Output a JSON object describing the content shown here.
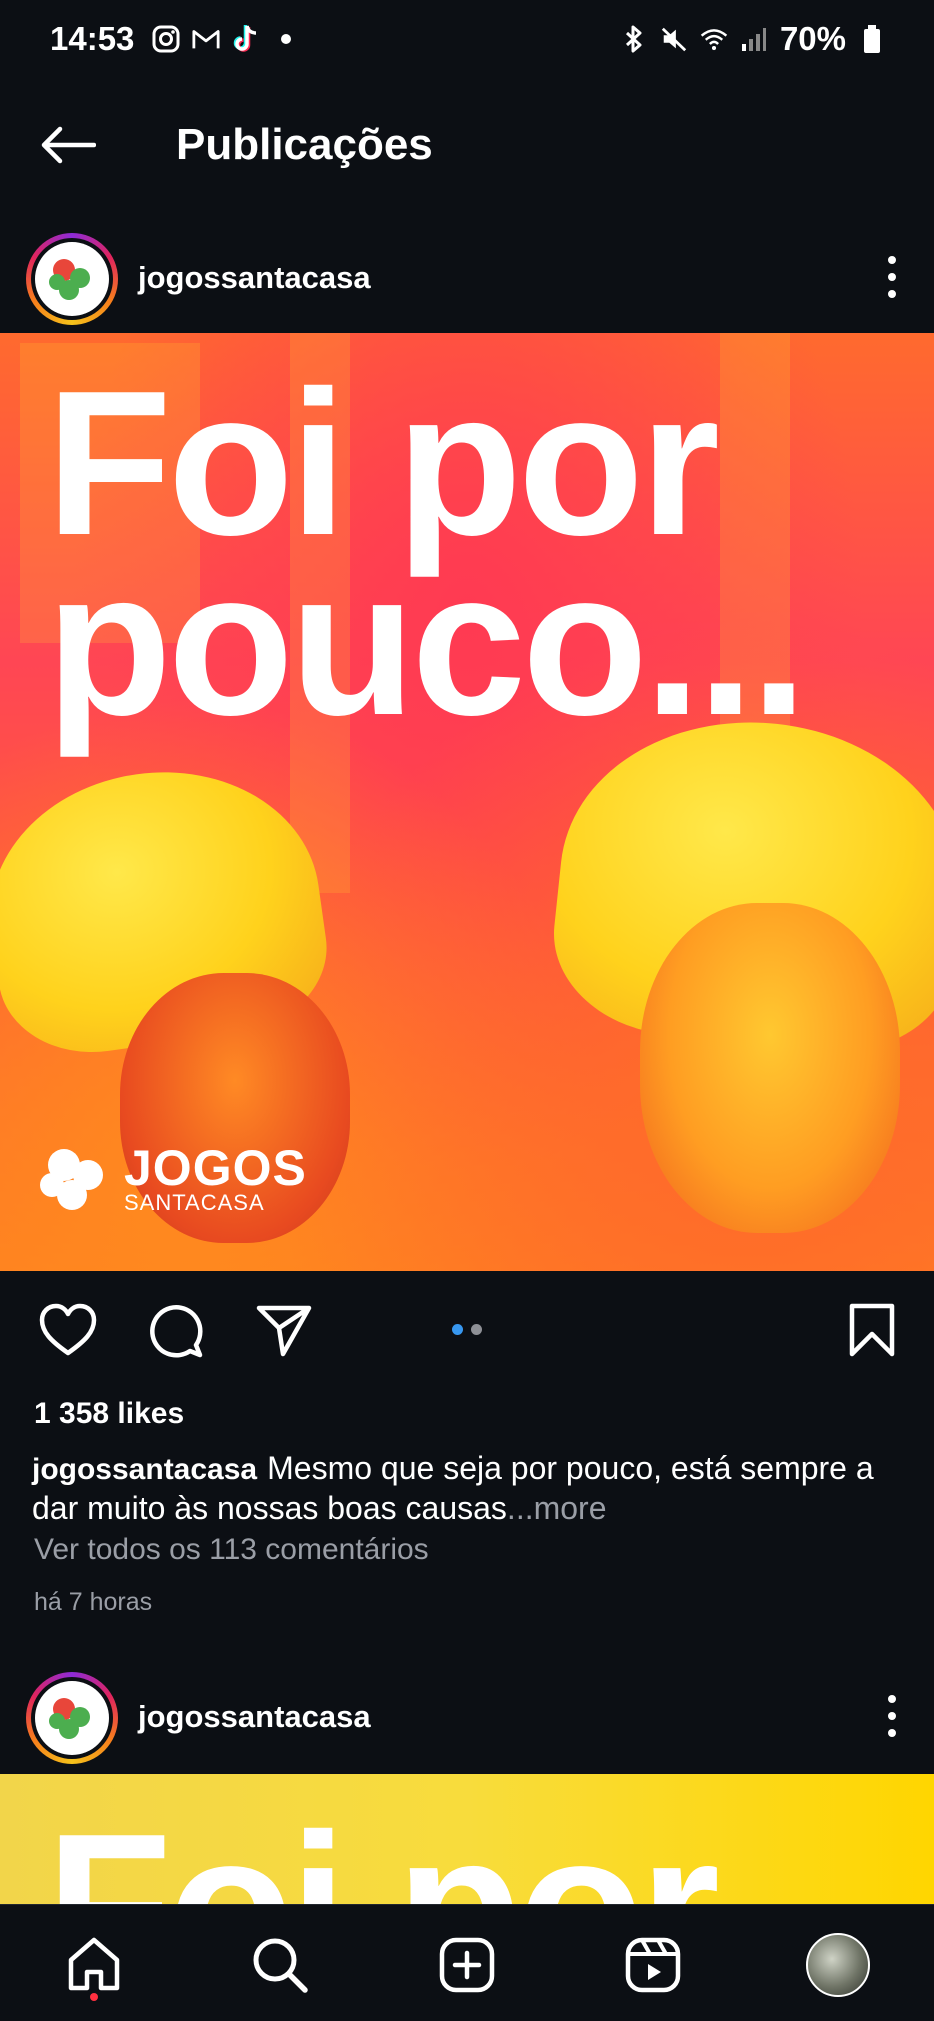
{
  "status_bar": {
    "time": "14:53",
    "left_icons": [
      "instagram-icon",
      "gmail-icon",
      "tiktok-icon",
      "dot-icon"
    ],
    "right_icons": [
      "bluetooth-icon",
      "mute-icon",
      "wifi-icon",
      "signal-icon",
      "battery-icon"
    ],
    "battery": "70%"
  },
  "header": {
    "title": "Publicações"
  },
  "post": {
    "username": "jogossantacasa",
    "image": {
      "headline_line1": "Foi por",
      "headline_line2": "pouco...",
      "brand_name": "JOGOS",
      "brand_sub": "SANTACASA"
    },
    "carousel": {
      "count": 2,
      "active": 0,
      "active_color": "#3797f0",
      "inactive_color": "#8e9096"
    },
    "likes": "1 358 likes",
    "caption_user": "jogossantacasa",
    "caption_text": "Mesmo que seja por pouco, está sempre a dar muito às nossas boas causas",
    "caption_more": "...more",
    "comments_link": "Ver todos os 113 comentários",
    "time_ago": "há 7 horas"
  },
  "next_post": {
    "username": "jogossantacasa",
    "headline_partial": "Foi por"
  },
  "colors": {
    "background": "#0c0f14",
    "muted_text": "#9a9ea6",
    "notification_dot": "#ff3040"
  },
  "bottom_nav": [
    "home-icon",
    "search-icon",
    "create-icon",
    "reels-icon",
    "profile-avatar"
  ]
}
